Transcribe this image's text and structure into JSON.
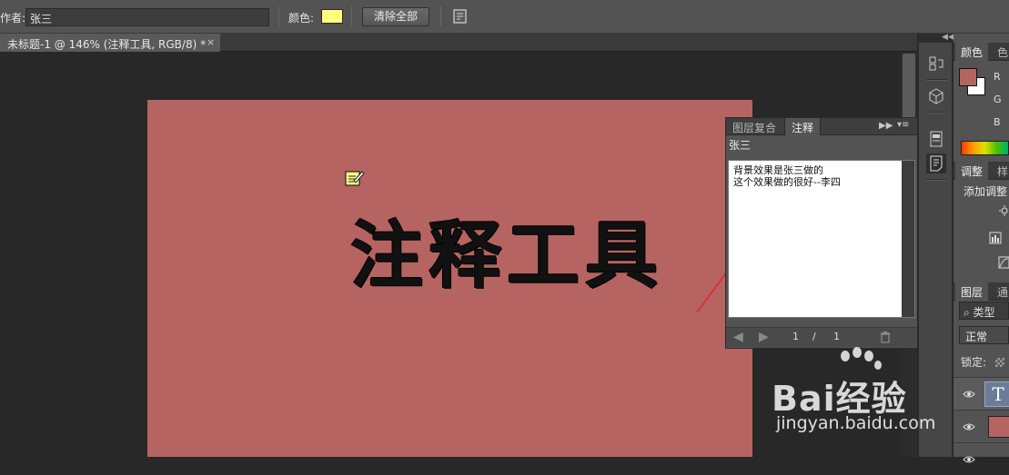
{
  "options_bar": {
    "author_label": "作者:",
    "author_value": "张三",
    "color_label": "颜色:",
    "color_value": "#ffff80",
    "clear_all_label": "清除全部"
  },
  "document": {
    "tab_title": "未标题-1 @ 146% (注释工具, RGB/8) *",
    "close_glyph": "×",
    "canvas_color": "#b66461",
    "canvas_text": "注释工具"
  },
  "notes_panel": {
    "tabs": [
      "图层复合",
      "注释"
    ],
    "active_tab": "注释",
    "author": "张三",
    "note_lines": [
      "背景效果是张三做的",
      "这个效果做的很好--李四"
    ],
    "current_index": "1",
    "separator": "/",
    "total": "1"
  },
  "right_panels": {
    "color_tabs": [
      "颜色",
      "色"
    ],
    "rgb_labels": [
      "R",
      "G",
      "B"
    ],
    "adjust_tabs": [
      "调整",
      "样"
    ],
    "add_adjustment_label": "添加调整",
    "layers_tabs": [
      "图层",
      "通"
    ],
    "filter_label": "类型",
    "blend_mode": "正常",
    "lock_label": "锁定:",
    "layer_text_thumb": "T"
  },
  "watermark": {
    "brand": "Bai经验",
    "url": "jingyan.baidu.com"
  }
}
